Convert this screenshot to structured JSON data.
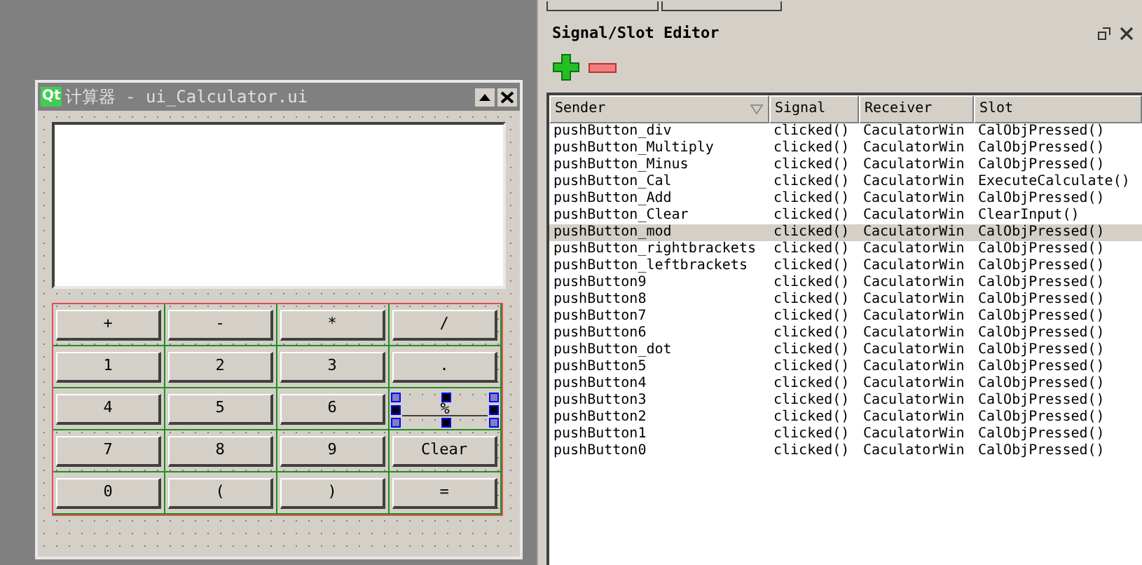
{
  "form_window": {
    "logo": "Qt",
    "title": "计算器 - ui_Calculator.ui"
  },
  "calculator_buttons": [
    {
      "label": "+",
      "selected": false
    },
    {
      "label": "-",
      "selected": false
    },
    {
      "label": "*",
      "selected": false
    },
    {
      "label": "/",
      "selected": false
    },
    {
      "label": "1",
      "selected": false
    },
    {
      "label": "2",
      "selected": false
    },
    {
      "label": "3",
      "selected": false
    },
    {
      "label": ".",
      "selected": false
    },
    {
      "label": "4",
      "selected": false
    },
    {
      "label": "5",
      "selected": false
    },
    {
      "label": "6",
      "selected": false
    },
    {
      "label": "%",
      "selected": true
    },
    {
      "label": "7",
      "selected": false
    },
    {
      "label": "8",
      "selected": false
    },
    {
      "label": "9",
      "selected": false
    },
    {
      "label": "Clear",
      "selected": false
    },
    {
      "label": "0",
      "selected": false
    },
    {
      "label": "(",
      "selected": false
    },
    {
      "label": ")",
      "selected": false
    },
    {
      "label": "=",
      "selected": false
    }
  ],
  "signal_slot_editor": {
    "title": "Signal/Slot Editor",
    "columns": [
      "Sender",
      "Signal",
      "Receiver",
      "Slot"
    ],
    "rows": [
      {
        "sender": "pushButton_div",
        "signal": "clicked()",
        "receiver": "CaculatorWin",
        "slot": "CalObjPressed()",
        "selected": false
      },
      {
        "sender": "pushButton_Multiply",
        "signal": "clicked()",
        "receiver": "CaculatorWin",
        "slot": "CalObjPressed()",
        "selected": false
      },
      {
        "sender": "pushButton_Minus",
        "signal": "clicked()",
        "receiver": "CaculatorWin",
        "slot": "CalObjPressed()",
        "selected": false
      },
      {
        "sender": "pushButton_Cal",
        "signal": "clicked()",
        "receiver": "CaculatorWin",
        "slot": "ExecuteCalculate()",
        "selected": false
      },
      {
        "sender": "pushButton_Add",
        "signal": "clicked()",
        "receiver": "CaculatorWin",
        "slot": "CalObjPressed()",
        "selected": false
      },
      {
        "sender": "pushButton_Clear",
        "signal": "clicked()",
        "receiver": "CaculatorWin",
        "slot": "ClearInput()",
        "selected": false
      },
      {
        "sender": "pushButton_mod",
        "signal": "clicked()",
        "receiver": "CaculatorWin",
        "slot": "CalObjPressed()",
        "selected": true
      },
      {
        "sender": "pushButton_rightbrackets",
        "signal": "clicked()",
        "receiver": "CaculatorWin",
        "slot": "CalObjPressed()",
        "selected": false
      },
      {
        "sender": "pushButton_leftbrackets",
        "signal": "clicked()",
        "receiver": "CaculatorWin",
        "slot": "CalObjPressed()",
        "selected": false
      },
      {
        "sender": "pushButton9",
        "signal": "clicked()",
        "receiver": "CaculatorWin",
        "slot": "CalObjPressed()",
        "selected": false
      },
      {
        "sender": "pushButton8",
        "signal": "clicked()",
        "receiver": "CaculatorWin",
        "slot": "CalObjPressed()",
        "selected": false
      },
      {
        "sender": "pushButton7",
        "signal": "clicked()",
        "receiver": "CaculatorWin",
        "slot": "CalObjPressed()",
        "selected": false
      },
      {
        "sender": "pushButton6",
        "signal": "clicked()",
        "receiver": "CaculatorWin",
        "slot": "CalObjPressed()",
        "selected": false
      },
      {
        "sender": "pushButton_dot",
        "signal": "clicked()",
        "receiver": "CaculatorWin",
        "slot": "CalObjPressed()",
        "selected": false
      },
      {
        "sender": "pushButton5",
        "signal": "clicked()",
        "receiver": "CaculatorWin",
        "slot": "CalObjPressed()",
        "selected": false
      },
      {
        "sender": "pushButton4",
        "signal": "clicked()",
        "receiver": "CaculatorWin",
        "slot": "CalObjPressed()",
        "selected": false
      },
      {
        "sender": "pushButton3",
        "signal": "clicked()",
        "receiver": "CaculatorWin",
        "slot": "CalObjPressed()",
        "selected": false
      },
      {
        "sender": "pushButton2",
        "signal": "clicked()",
        "receiver": "CaculatorWin",
        "slot": "CalObjPressed()",
        "selected": false
      },
      {
        "sender": "pushButton1",
        "signal": "clicked()",
        "receiver": "CaculatorWin",
        "slot": "CalObjPressed()",
        "selected": false
      },
      {
        "sender": "pushButton0",
        "signal": "clicked()",
        "receiver": "CaculatorWin",
        "slot": "CalObjPressed()",
        "selected": false
      }
    ]
  }
}
